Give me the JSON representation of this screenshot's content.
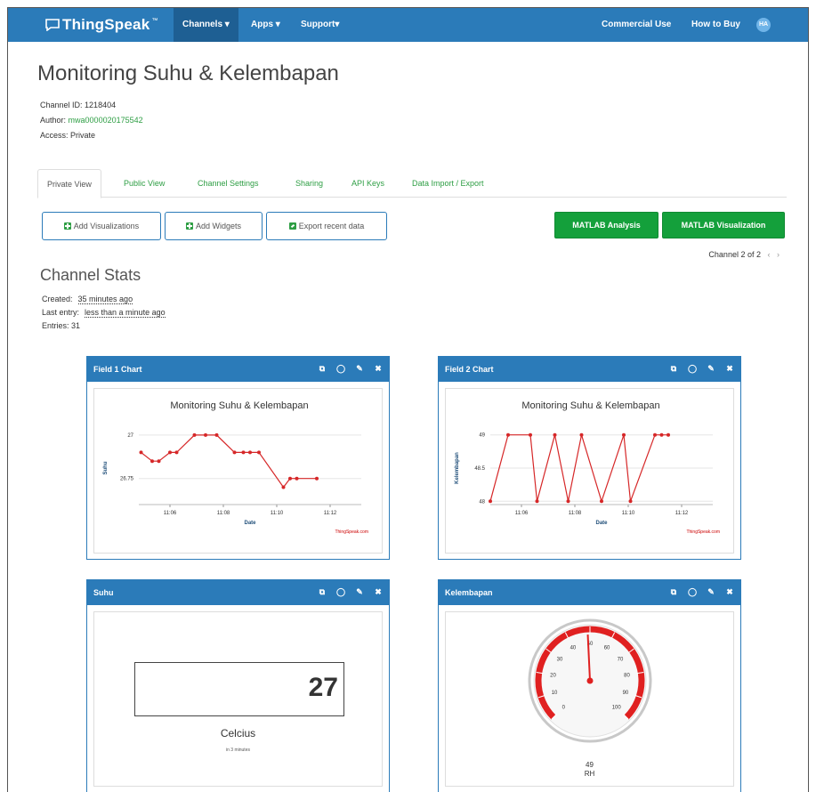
{
  "navbar": {
    "brand": "ThingSpeak",
    "brand_tm": "™",
    "items": [
      "Channels",
      "Apps",
      "Support"
    ],
    "right": [
      "Commercial Use",
      "How to Buy"
    ],
    "avatar": "HA"
  },
  "header": {
    "title": "Monitoring Suhu & Kelembapan",
    "channel_id_label": "Channel ID:",
    "channel_id": "1218404",
    "author_label": "Author:",
    "author": "mwa0000020175542",
    "access_label": "Access:",
    "access": "Private"
  },
  "tabs": [
    "Private View",
    "Public View",
    "Channel Settings",
    "Sharing",
    "API Keys",
    "Data Import / Export"
  ],
  "buttons": {
    "add_visualizations": "Add Visualizations",
    "add_widgets": "Add Widgets",
    "export": "Export recent data",
    "matlab_analysis": "MATLAB Analysis",
    "matlab_visualization": "MATLAB Visualization"
  },
  "channel_nav": "Channel 2 of 2",
  "stats": {
    "title": "Channel Stats",
    "created_label": "Created:",
    "created": "35 minutes ago",
    "last_entry_label": "Last entry:",
    "last_entry": "less than a minute ago",
    "entries_label": "Entries:",
    "entries": "31"
  },
  "colors": {
    "nav": "#2b7bb9",
    "green": "#14a03b",
    "line": "#d62728"
  },
  "panels": {
    "field1": {
      "title": "Field 1 Chart"
    },
    "field2": {
      "title": "Field 2 Chart"
    },
    "suhu": {
      "title": "Suhu",
      "value": "27",
      "unit": "Celcius",
      "sub": "in 3 minutes"
    },
    "kelembapan": {
      "title": "Kelembapan",
      "value": "49",
      "unit": "RH"
    }
  },
  "chart_data": [
    {
      "type": "line",
      "title": "Monitoring Suhu & Kelembapan",
      "xlabel": "Date",
      "ylabel": "Suhu",
      "credit": "ThingSpeak.com",
      "x_ticks": [
        "11:06",
        "11:08",
        "11:10",
        "11:12"
      ],
      "x_range": [
        0,
        10
      ],
      "y_ticks": [
        27,
        26.75
      ],
      "ylim": [
        26.6,
        27.02
      ],
      "points": [
        [
          0.1,
          26.9
        ],
        [
          0.6,
          26.85
        ],
        [
          0.9,
          26.85
        ],
        [
          1.4,
          26.9
        ],
        [
          1.7,
          26.9
        ],
        [
          2.5,
          27
        ],
        [
          3.0,
          27
        ],
        [
          3.5,
          27
        ],
        [
          4.3,
          26.9
        ],
        [
          4.7,
          26.9
        ],
        [
          5.0,
          26.9
        ],
        [
          5.4,
          26.9
        ],
        [
          6.5,
          26.7
        ],
        [
          6.8,
          26.75
        ],
        [
          7.1,
          26.75
        ],
        [
          8.0,
          26.75
        ]
      ]
    },
    {
      "type": "line",
      "title": "Monitoring Suhu & Kelembapan",
      "xlabel": "Date",
      "ylabel": "Kelembapan",
      "credit": "ThingSpeak.com",
      "x_ticks": [
        "11:06",
        "11:08",
        "11:10",
        "11:12"
      ],
      "x_range": [
        0,
        10
      ],
      "y_ticks": [
        49,
        48.5,
        48
      ],
      "ylim": [
        47.95,
        49.05
      ],
      "points": [
        [
          0,
          48
        ],
        [
          0.8,
          49
        ],
        [
          1.8,
          49
        ],
        [
          2.1,
          48
        ],
        [
          2.9,
          49
        ],
        [
          3.5,
          48
        ],
        [
          4.1,
          49
        ],
        [
          5.0,
          48
        ],
        [
          6.0,
          49
        ],
        [
          6.3,
          48
        ],
        [
          7.4,
          49
        ],
        [
          7.7,
          49
        ],
        [
          8.0,
          49
        ]
      ]
    }
  ],
  "gauge": {
    "min": 0,
    "max": 100,
    "value": 49,
    "ticks": [
      "0",
      "10",
      "20",
      "30",
      "40",
      "50",
      "60",
      "70",
      "80",
      "90",
      "100"
    ]
  }
}
